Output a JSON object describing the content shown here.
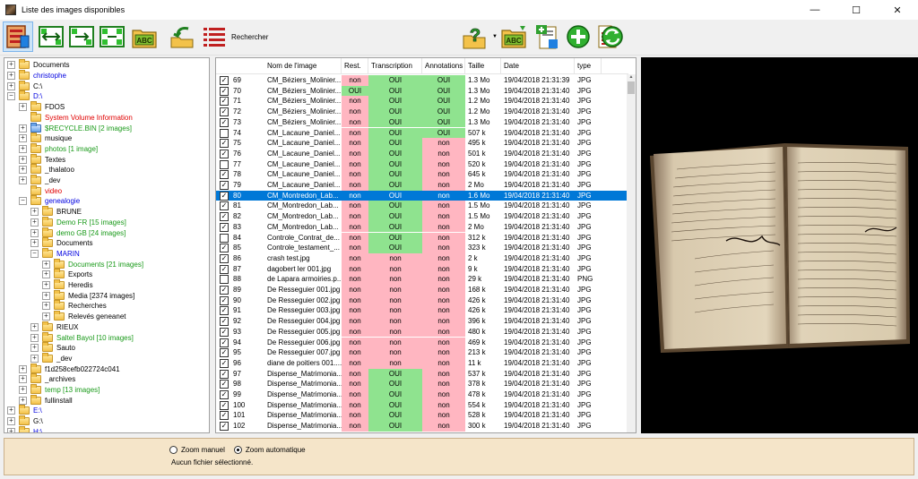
{
  "window": {
    "title": "Liste des images disponibles",
    "minimize": "—",
    "maximize": "☐",
    "close": "✕"
  },
  "toolbar": {
    "search_label": "Rechercher",
    "dropdown_arrow": "▼"
  },
  "tree": {
    "items": [
      {
        "label": "Documents",
        "depth": 1,
        "exp": "+",
        "color": "black"
      },
      {
        "label": "christophe",
        "depth": 1,
        "exp": "+",
        "color": "blue"
      },
      {
        "label": "C:\\",
        "depth": 1,
        "exp": "+",
        "color": "black"
      },
      {
        "label": "D:\\",
        "depth": 1,
        "exp": "-",
        "color": "blue"
      },
      {
        "label": "FDOS",
        "depth": 2,
        "exp": "+",
        "color": "black"
      },
      {
        "label": "System Volume Information",
        "depth": 2,
        "exp": "",
        "color": "red"
      },
      {
        "label": "$RECYCLE.BIN [2 images]",
        "depth": 2,
        "exp": "+",
        "color": "green",
        "special": true
      },
      {
        "label": "musique",
        "depth": 2,
        "exp": "+",
        "color": "black"
      },
      {
        "label": "photos [1 image]",
        "depth": 2,
        "exp": "+",
        "color": "green"
      },
      {
        "label": "Textes",
        "depth": 2,
        "exp": "+",
        "color": "black"
      },
      {
        "label": "_thalatoo",
        "depth": 2,
        "exp": "+",
        "color": "black"
      },
      {
        "label": "_dev",
        "depth": 2,
        "exp": "+",
        "color": "black"
      },
      {
        "label": "video",
        "depth": 2,
        "exp": "",
        "color": "red"
      },
      {
        "label": "genealogie",
        "depth": 2,
        "exp": "-",
        "color": "blue"
      },
      {
        "label": "BRUNE",
        "depth": 3,
        "exp": "+",
        "color": "black"
      },
      {
        "label": "Demo FR [15 images]",
        "depth": 3,
        "exp": "+",
        "color": "green"
      },
      {
        "label": "demo GB [24 images]",
        "depth": 3,
        "exp": "+",
        "color": "green"
      },
      {
        "label": "Documents",
        "depth": 3,
        "exp": "+",
        "color": "black"
      },
      {
        "label": "MARIN",
        "depth": 3,
        "exp": "-",
        "color": "blue"
      },
      {
        "label": "Documents [21 images]",
        "depth": 4,
        "exp": "+",
        "color": "green"
      },
      {
        "label": "Exports",
        "depth": 4,
        "exp": "+",
        "color": "black"
      },
      {
        "label": "Heredis",
        "depth": 4,
        "exp": "+",
        "color": "black"
      },
      {
        "label": "Media [2374 images]",
        "depth": 4,
        "exp": "+",
        "color": "black"
      },
      {
        "label": "Recherches",
        "depth": 4,
        "exp": "+",
        "color": "black"
      },
      {
        "label": "Relevés geneanet",
        "depth": 4,
        "exp": "+",
        "color": "black"
      },
      {
        "label": "RIEUX",
        "depth": 3,
        "exp": "+",
        "color": "black"
      },
      {
        "label": "Saltel Bayol [10 images]",
        "depth": 3,
        "exp": "+",
        "color": "green"
      },
      {
        "label": "Sauto",
        "depth": 3,
        "exp": "+",
        "color": "black"
      },
      {
        "label": "_dev",
        "depth": 3,
        "exp": "+",
        "color": "black"
      },
      {
        "label": "f1d258cefb022724c041",
        "depth": 2,
        "exp": "+",
        "color": "black"
      },
      {
        "label": "_archives",
        "depth": 2,
        "exp": "+",
        "color": "black"
      },
      {
        "label": "temp [13 images]",
        "depth": 2,
        "exp": "+",
        "color": "green"
      },
      {
        "label": "fullinstall",
        "depth": 2,
        "exp": "+",
        "color": "black"
      },
      {
        "label": "E:\\",
        "depth": 1,
        "exp": "+",
        "color": "blue"
      },
      {
        "label": "G:\\",
        "depth": 1,
        "exp": "+",
        "color": "black"
      },
      {
        "label": "H:\\",
        "depth": 1,
        "exp": "+",
        "color": "blue"
      }
    ]
  },
  "table": {
    "headers": [
      "Nom de l'image",
      "Rest.",
      "Transcription",
      "Annotations",
      "Taille",
      "Date",
      "type"
    ],
    "rows": [
      {
        "checked": true,
        "num": "69",
        "name": "CM_Béziers_Molinier...",
        "rest": "non",
        "trans": "OUI",
        "annot": "OUI",
        "size": "1.3 Mo",
        "date": "19/04/2018 21:31:39",
        "type": "JPG"
      },
      {
        "checked": true,
        "num": "70",
        "name": "CM_Béziers_Molinier...",
        "rest": "OUI",
        "trans": "OUI",
        "annot": "OUI",
        "size": "1.3 Mo",
        "date": "19/04/2018 21:31:40",
        "type": "JPG"
      },
      {
        "checked": true,
        "num": "71",
        "name": "CM_Béziers_Molinier...",
        "rest": "non",
        "trans": "OUI",
        "annot": "OUI",
        "size": "1.2 Mo",
        "date": "19/04/2018 21:31:40",
        "type": "JPG"
      },
      {
        "checked": true,
        "num": "72",
        "name": "CM_Béziers_Molinier...",
        "rest": "non",
        "trans": "OUI",
        "annot": "OUI",
        "size": "1.2 Mo",
        "date": "19/04/2018 21:31:40",
        "type": "JPG"
      },
      {
        "checked": true,
        "num": "73",
        "name": "CM_Béziers_Molinier...",
        "rest": "non",
        "trans": "OUI",
        "annot": "OUI",
        "size": "1.3 Mo",
        "date": "19/04/2018 21:31:40",
        "type": "JPG"
      },
      {
        "checked": false,
        "num": "74",
        "name": "CM_Lacaune_Daniel...",
        "rest": "non",
        "trans": "OUI",
        "annot": "OUI",
        "size": "507 k",
        "date": "19/04/2018 21:31:40",
        "type": "JPG"
      },
      {
        "checked": true,
        "num": "75",
        "name": "CM_Lacaune_Daniel...",
        "rest": "non",
        "trans": "OUI",
        "annot": "non",
        "size": "495 k",
        "date": "19/04/2018 21:31:40",
        "type": "JPG"
      },
      {
        "checked": true,
        "num": "76",
        "name": "CM_Lacaune_Daniel...",
        "rest": "non",
        "trans": "OUI",
        "annot": "non",
        "size": "501 k",
        "date": "19/04/2018 21:31:40",
        "type": "JPG"
      },
      {
        "checked": false,
        "num": "77",
        "name": "CM_Lacaune_Daniel...",
        "rest": "non",
        "trans": "OUI",
        "annot": "non",
        "size": "520 k",
        "date": "19/04/2018 21:31:40",
        "type": "JPG"
      },
      {
        "checked": true,
        "num": "78",
        "name": "CM_Lacaune_Daniel...",
        "rest": "non",
        "trans": "OUI",
        "annot": "non",
        "size": "645 k",
        "date": "19/04/2018 21:31:40",
        "type": "JPG"
      },
      {
        "checked": true,
        "num": "79",
        "name": "CM_Lacaune_Daniel...",
        "rest": "non",
        "trans": "OUI",
        "annot": "non",
        "size": "2 Mo",
        "date": "19/04/2018 21:31:40",
        "type": "JPG"
      },
      {
        "checked": true,
        "num": "80",
        "name": "CM_Montredon_Lab...",
        "rest": "non",
        "trans": "OUI",
        "annot": "non",
        "size": "1.6 Mo",
        "date": "19/04/2018 21:31:40",
        "type": "JPG",
        "selected": true
      },
      {
        "checked": true,
        "num": "81",
        "name": "CM_Montredon_Lab...",
        "rest": "non",
        "trans": "OUI",
        "annot": "non",
        "size": "1.5 Mo",
        "date": "19/04/2018 21:31:40",
        "type": "JPG"
      },
      {
        "checked": true,
        "num": "82",
        "name": "CM_Montredon_Lab...",
        "rest": "non",
        "trans": "OUI",
        "annot": "non",
        "size": "1.5 Mo",
        "date": "19/04/2018 21:31:40",
        "type": "JPG"
      },
      {
        "checked": true,
        "num": "83",
        "name": "CM_Montredon_Lab...",
        "rest": "non",
        "trans": "OUI",
        "annot": "non",
        "size": "2 Mo",
        "date": "19/04/2018 21:31:40",
        "type": "JPG"
      },
      {
        "checked": false,
        "num": "84",
        "name": "Controle_Contrat_de...",
        "rest": "non",
        "trans": "OUI",
        "annot": "non",
        "size": "312 k",
        "date": "19/04/2018 21:31:40",
        "type": "JPG"
      },
      {
        "checked": true,
        "num": "85",
        "name": "Controle_testament_...",
        "rest": "non",
        "trans": "OUI",
        "annot": "non",
        "size": "323 k",
        "date": "19/04/2018 21:31:40",
        "type": "JPG"
      },
      {
        "checked": true,
        "num": "86",
        "name": "crash test.jpg",
        "rest": "non",
        "trans": "non",
        "annot": "non",
        "size": "2 k",
        "date": "19/04/2018 21:31:40",
        "type": "JPG"
      },
      {
        "checked": true,
        "num": "87",
        "name": "dagobert ler 001.jpg",
        "rest": "non",
        "trans": "non",
        "annot": "non",
        "size": "9 k",
        "date": "19/04/2018 21:31:40",
        "type": "JPG"
      },
      {
        "checked": false,
        "num": "88",
        "name": "de Lapara armoiries.p...",
        "rest": "non",
        "trans": "non",
        "annot": "non",
        "size": "29 k",
        "date": "19/04/2018 21:31:40",
        "type": "PNG"
      },
      {
        "checked": true,
        "num": "89",
        "name": "De Resseguier 001.jpg",
        "rest": "non",
        "trans": "non",
        "annot": "non",
        "size": "168 k",
        "date": "19/04/2018 21:31:40",
        "type": "JPG"
      },
      {
        "checked": true,
        "num": "90",
        "name": "De Resseguier 002.jpg",
        "rest": "non",
        "trans": "non",
        "annot": "non",
        "size": "426 k",
        "date": "19/04/2018 21:31:40",
        "type": "JPG"
      },
      {
        "checked": true,
        "num": "91",
        "name": "De Resseguier 003.jpg",
        "rest": "non",
        "trans": "non",
        "annot": "non",
        "size": "426 k",
        "date": "19/04/2018 21:31:40",
        "type": "JPG"
      },
      {
        "checked": true,
        "num": "92",
        "name": "De Resseguier 004.jpg",
        "rest": "non",
        "trans": "non",
        "annot": "non",
        "size": "396 k",
        "date": "19/04/2018 21:31:40",
        "type": "JPG"
      },
      {
        "checked": true,
        "num": "93",
        "name": "De Resseguier 005.jpg",
        "rest": "non",
        "trans": "non",
        "annot": "non",
        "size": "480 k",
        "date": "19/04/2018 21:31:40",
        "type": "JPG"
      },
      {
        "checked": true,
        "num": "94",
        "name": "De Resseguier 006.jpg",
        "rest": "non",
        "trans": "non",
        "annot": "non",
        "size": "469 k",
        "date": "19/04/2018 21:31:40",
        "type": "JPG"
      },
      {
        "checked": true,
        "num": "95",
        "name": "De Resseguier 007.jpg",
        "rest": "non",
        "trans": "non",
        "annot": "non",
        "size": "213 k",
        "date": "19/04/2018 21:31:40",
        "type": "JPG"
      },
      {
        "checked": true,
        "num": "96",
        "name": "diane de poitiers 001....",
        "rest": "non",
        "trans": "non",
        "annot": "non",
        "size": "11 k",
        "date": "19/04/2018 21:31:40",
        "type": "JPG"
      },
      {
        "checked": true,
        "num": "97",
        "name": "Dispense_Matrimonia...",
        "rest": "non",
        "trans": "OUI",
        "annot": "non",
        "size": "537 k",
        "date": "19/04/2018 21:31:40",
        "type": "JPG"
      },
      {
        "checked": true,
        "num": "98",
        "name": "Dispense_Matrimonia...",
        "rest": "non",
        "trans": "OUI",
        "annot": "non",
        "size": "378 k",
        "date": "19/04/2018 21:31:40",
        "type": "JPG"
      },
      {
        "checked": true,
        "num": "99",
        "name": "Dispense_Matrimonia...",
        "rest": "non",
        "trans": "OUI",
        "annot": "non",
        "size": "478 k",
        "date": "19/04/2018 21:31:40",
        "type": "JPG"
      },
      {
        "checked": true,
        "num": "100",
        "name": "Dispense_Matrimonia...",
        "rest": "non",
        "trans": "OUI",
        "annot": "non",
        "size": "554 k",
        "date": "19/04/2018 21:31:40",
        "type": "JPG"
      },
      {
        "checked": true,
        "num": "101",
        "name": "Dispense_Matrimonia...",
        "rest": "non",
        "trans": "OUI",
        "annot": "non",
        "size": "528 k",
        "date": "19/04/2018 21:31:40",
        "type": "JPG"
      },
      {
        "checked": true,
        "num": "102",
        "name": "Dispense_Matrimonia...",
        "rest": "non",
        "trans": "OUI",
        "annot": "non",
        "size": "300 k",
        "date": "19/04/2018 21:31:40",
        "type": "JPG"
      }
    ]
  },
  "bottom": {
    "zoom_manual": "Zoom manuel",
    "zoom_auto": "Zoom automatique",
    "status": "Aucun fichier sélectionné."
  },
  "colors": {
    "selected_row": "#0078d7",
    "no_cell": "#ffb6c1",
    "yes_cell": "#8fe38f",
    "panel_bg": "#f5e5c9"
  },
  "icons": [
    "image-list-icon",
    "fit-width-icon",
    "fit-height-icon",
    "fit-page-icon",
    "abc-folder-icon",
    "back-arrow-icon",
    "list-icon",
    "help-icon",
    "abc-folder-icon",
    "add-image-icon",
    "add-icon",
    "new-document-icon",
    "refresh-icon"
  ]
}
